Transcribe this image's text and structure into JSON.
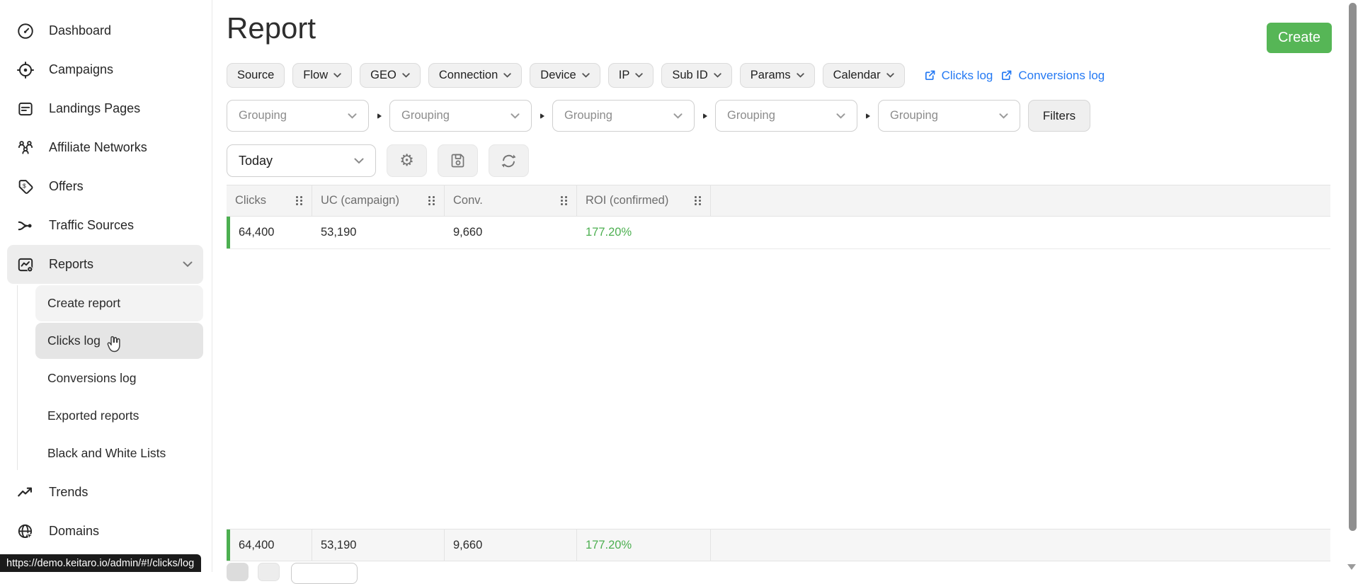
{
  "header": {
    "title": "Report",
    "create_label": "Create"
  },
  "status_url": "https://demo.keitaro.io/admin/#!/clicks/log",
  "sidebar": {
    "items": [
      {
        "label": "Dashboard"
      },
      {
        "label": "Campaigns"
      },
      {
        "label": "Landings Pages"
      },
      {
        "label": "Affiliate Networks"
      },
      {
        "label": "Offers"
      },
      {
        "label": "Traffic Sources"
      },
      {
        "label": "Reports",
        "expanded": true
      },
      {
        "label": "Trends"
      },
      {
        "label": "Domains"
      }
    ],
    "reports_children": [
      {
        "label": "Create report",
        "state": "highlighted"
      },
      {
        "label": "Clicks log",
        "state": "hovered"
      },
      {
        "label": "Conversions log"
      },
      {
        "label": "Exported reports"
      },
      {
        "label": "Black and White Lists"
      }
    ]
  },
  "filters": {
    "chips": [
      {
        "label": "Source",
        "chevron": false
      },
      {
        "label": "Flow",
        "chevron": true
      },
      {
        "label": "GEO",
        "chevron": true
      },
      {
        "label": "Connection",
        "chevron": true
      },
      {
        "label": "Device",
        "chevron": true
      },
      {
        "label": "IP",
        "chevron": true
      },
      {
        "label": "Sub ID",
        "chevron": true
      },
      {
        "label": "Params",
        "chevron": true
      },
      {
        "label": "Calendar",
        "chevron": true
      }
    ],
    "links": [
      {
        "label": "Clicks log"
      },
      {
        "label": "Conversions log"
      }
    ]
  },
  "grouping": {
    "placeholder": "Grouping",
    "filters_label": "Filters"
  },
  "toolbar": {
    "date_range": "Today"
  },
  "table": {
    "columns": [
      {
        "label": "Clicks"
      },
      {
        "label": "UC (campaign)"
      },
      {
        "label": "Conv."
      },
      {
        "label": "ROI (confirmed)"
      }
    ],
    "row": {
      "clicks": "64,400",
      "uc": "53,190",
      "conv": "9,660",
      "roi": "177.20%"
    },
    "footer": {
      "clicks": "64,400",
      "uc": "53,190",
      "conv": "9,660",
      "roi": "177.20%"
    }
  },
  "icons": {
    "gear": "⚙"
  },
  "colors": {
    "accent_green": "#4caf50",
    "button_green": "#56b656",
    "link_blue": "#2479f3",
    "status_bg": "#1b1b1b"
  }
}
